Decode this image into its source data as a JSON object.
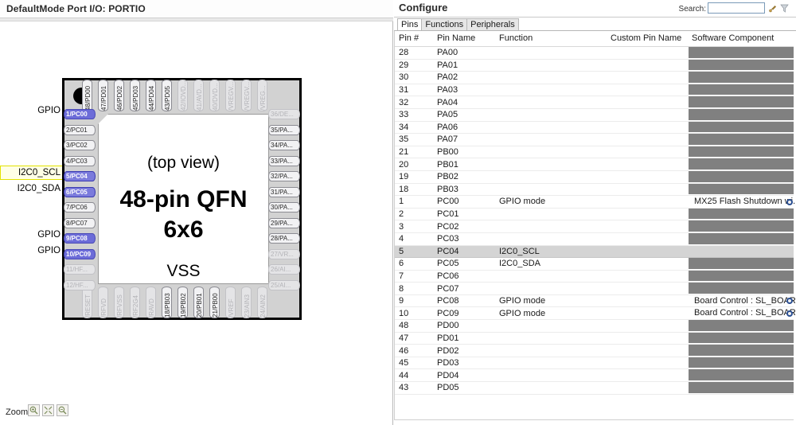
{
  "left_panel": {
    "title": "DefaultMode Port I/O: PORTIO",
    "chip": {
      "top_view": "(top view)",
      "part": "48-pin QFN",
      "size": "6x6",
      "ground": "VSS"
    },
    "zoom": {
      "label": "Zoom:",
      "buttons": [
        "zoom-in-icon",
        "zoom-fit-icon",
        "zoom-out-icon"
      ]
    },
    "pin_labels": [
      {
        "text": "GPIO",
        "pin": "1/PC00"
      },
      {
        "text": "I2C0_SCL",
        "pin": "5/PC04"
      },
      {
        "text": "I2C0_SDA",
        "pin": "6/PC05"
      },
      {
        "text": "GPIO",
        "pin": "9/PC08"
      },
      {
        "text": "GPIO",
        "pin": "10/PC09"
      }
    ],
    "pins_left": [
      {
        "label": "1/PC00",
        "state": "active"
      },
      {
        "label": "2/PC01",
        "state": "normal"
      },
      {
        "label": "3/PC02",
        "state": "normal"
      },
      {
        "label": "4/PC03",
        "state": "normal"
      },
      {
        "label": "5/PC04",
        "state": "sel"
      },
      {
        "label": "6/PC05",
        "state": "sel"
      },
      {
        "label": "7/PC06",
        "state": "normal"
      },
      {
        "label": "8/PC07",
        "state": "normal"
      },
      {
        "label": "9/PC08",
        "state": "active"
      },
      {
        "label": "10/PC09",
        "state": "active"
      },
      {
        "label": "11/HF...",
        "state": "dim"
      },
      {
        "label": "12/HF...",
        "state": "dim"
      }
    ],
    "pins_top": [
      {
        "label": "48/PD00",
        "state": "normal"
      },
      {
        "label": "47/PD01",
        "state": "normal"
      },
      {
        "label": "46/PD02",
        "state": "normal"
      },
      {
        "label": "45/PD03",
        "state": "normal"
      },
      {
        "label": "44/PD04",
        "state": "normal"
      },
      {
        "label": "43/PD05",
        "state": "normal"
      },
      {
        "label": "42/IOVD...",
        "state": "dim"
      },
      {
        "label": "41/AVD...",
        "state": "dim"
      },
      {
        "label": "40/DVD...",
        "state": "dim"
      },
      {
        "label": "/VREGV...",
        "state": "dim"
      },
      {
        "label": "/VREGV...",
        "state": "dim"
      },
      {
        "label": "/VREG...",
        "state": "dim"
      }
    ],
    "pins_right": [
      {
        "label": "36/DE...",
        "state": "dim"
      },
      {
        "label": "35/PA...",
        "state": "normal"
      },
      {
        "label": "34/PA...",
        "state": "normal"
      },
      {
        "label": "33/PA...",
        "state": "normal"
      },
      {
        "label": "32/PA...",
        "state": "normal"
      },
      {
        "label": "31/PA...",
        "state": "normal"
      },
      {
        "label": "30/PA...",
        "state": "normal"
      },
      {
        "label": "29/PA...",
        "state": "normal"
      },
      {
        "label": "28/PA...",
        "state": "normal"
      },
      {
        "label": "27/VR...",
        "state": "dim"
      },
      {
        "label": "26/AI...",
        "state": "dim"
      },
      {
        "label": "25/AI...",
        "state": "dim"
      }
    ],
    "pins_bottom": [
      {
        "label": "/RESET",
        "state": "dim"
      },
      {
        "label": "/RFVD",
        "state": "dim"
      },
      {
        "label": "/RFVSS",
        "state": "dim"
      },
      {
        "label": "/RF2G4",
        "state": "dim"
      },
      {
        "label": "/RAVD",
        "state": "dim"
      },
      {
        "label": "18/PB03",
        "state": "normal"
      },
      {
        "label": "19/PB02",
        "state": "normal"
      },
      {
        "label": "20/PB01",
        "state": "normal"
      },
      {
        "label": "21/PB00",
        "state": "normal"
      },
      {
        "label": "/VREF",
        "state": "dim"
      },
      {
        "label": "23/AIN3",
        "state": "dim"
      },
      {
        "label": "24/AIN2",
        "state": "dim"
      }
    ]
  },
  "right_panel": {
    "title": "Configure",
    "search": {
      "label": "Search:",
      "value": "",
      "placeholder": ""
    },
    "search_icons": [
      "pin-search-icon",
      "filter-icon"
    ],
    "tabs": [
      {
        "label": "Pins",
        "active": true
      },
      {
        "label": "Functions",
        "active": false
      },
      {
        "label": "Peripherals",
        "active": false
      }
    ],
    "table": {
      "columns": [
        "Pin #",
        "Pin Name",
        "Function",
        "Custom Pin Name",
        "Software Component"
      ],
      "rows": [
        {
          "pin": "28",
          "name": "PA00",
          "function": "",
          "custom": "",
          "software": "",
          "selected": false
        },
        {
          "pin": "29",
          "name": "PA01",
          "function": "",
          "custom": "",
          "software": "",
          "selected": false
        },
        {
          "pin": "30",
          "name": "PA02",
          "function": "",
          "custom": "",
          "software": "",
          "selected": false
        },
        {
          "pin": "31",
          "name": "PA03",
          "function": "",
          "custom": "",
          "software": "",
          "selected": false
        },
        {
          "pin": "32",
          "name": "PA04",
          "function": "",
          "custom": "",
          "software": "",
          "selected": false
        },
        {
          "pin": "33",
          "name": "PA05",
          "function": "",
          "custom": "",
          "software": "",
          "selected": false
        },
        {
          "pin": "34",
          "name": "PA06",
          "function": "",
          "custom": "",
          "software": "",
          "selected": false
        },
        {
          "pin": "35",
          "name": "PA07",
          "function": "",
          "custom": "",
          "software": "",
          "selected": false
        },
        {
          "pin": "21",
          "name": "PB00",
          "function": "",
          "custom": "",
          "software": "",
          "selected": false
        },
        {
          "pin": "20",
          "name": "PB01",
          "function": "",
          "custom": "",
          "software": "",
          "selected": false
        },
        {
          "pin": "19",
          "name": "PB02",
          "function": "",
          "custom": "",
          "software": "",
          "selected": false
        },
        {
          "pin": "18",
          "name": "PB03",
          "function": "",
          "custom": "",
          "software": "",
          "selected": false
        },
        {
          "pin": "1",
          "name": "PC00",
          "function": "GPIO mode",
          "custom": "",
          "software": "MX25 Flash Shutdown wi...",
          "selected": false
        },
        {
          "pin": "2",
          "name": "PC01",
          "function": "",
          "custom": "",
          "software": "",
          "selected": false
        },
        {
          "pin": "3",
          "name": "PC02",
          "function": "",
          "custom": "",
          "software": "",
          "selected": false
        },
        {
          "pin": "4",
          "name": "PC03",
          "function": "",
          "custom": "",
          "software": "",
          "selected": false
        },
        {
          "pin": "5",
          "name": "PC04",
          "function": "I2C0_SCL",
          "custom": "",
          "software": "",
          "selected": true
        },
        {
          "pin": "6",
          "name": "PC05",
          "function": "I2C0_SDA",
          "custom": "",
          "software": "",
          "selected": false
        },
        {
          "pin": "7",
          "name": "PC06",
          "function": "",
          "custom": "",
          "software": "",
          "selected": false
        },
        {
          "pin": "8",
          "name": "PC07",
          "function": "",
          "custom": "",
          "software": "",
          "selected": false
        },
        {
          "pin": "9",
          "name": "PC08",
          "function": "GPIO mode",
          "custom": "",
          "software": "Board Control : SL_BOAR...",
          "selected": false
        },
        {
          "pin": "10",
          "name": "PC09",
          "function": "GPIO mode",
          "custom": "",
          "software": "Board Control : SL_BOAR...",
          "selected": false
        },
        {
          "pin": "48",
          "name": "PD00",
          "function": "",
          "custom": "",
          "software": "",
          "selected": false
        },
        {
          "pin": "47",
          "name": "PD01",
          "function": "",
          "custom": "",
          "software": "",
          "selected": false
        },
        {
          "pin": "46",
          "name": "PD02",
          "function": "",
          "custom": "",
          "software": "",
          "selected": false
        },
        {
          "pin": "45",
          "name": "PD03",
          "function": "",
          "custom": "",
          "software": "",
          "selected": false
        },
        {
          "pin": "44",
          "name": "PD04",
          "function": "",
          "custom": "",
          "software": "",
          "selected": false
        },
        {
          "pin": "43",
          "name": "PD05",
          "function": "",
          "custom": "",
          "software": "",
          "selected": false
        }
      ]
    }
  },
  "colors": {
    "pin_active": "#6c6cd8",
    "pin_selected_row": "#d4d4d4",
    "software_cell": "#808080",
    "highlight_outline": "#e2e200"
  }
}
